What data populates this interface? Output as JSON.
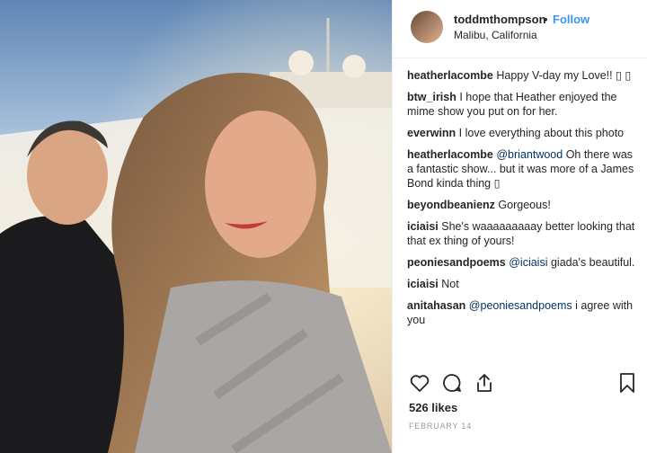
{
  "post": {
    "username": "toddmthompson",
    "separator": "•",
    "follow_label": "Follow",
    "location": "Malibu, California",
    "likes": "526 likes",
    "date": "FEBRUARY 14"
  },
  "comments": [
    {
      "user": "heatherlacombe",
      "mention": "",
      "text": "Happy V-day my Love!! ▯ ▯"
    },
    {
      "user": "btw_irish",
      "mention": "",
      "text": "I hope that Heather enjoyed the mime show you put on for her."
    },
    {
      "user": "everwinn",
      "mention": "",
      "text": "I love everything about this photo"
    },
    {
      "user": "heatherlacombe",
      "mention": "@briantwood",
      "text": "Oh there was a fantastic show... but it was more of a James Bond kinda thing ▯"
    },
    {
      "user": "beyondbeanienz",
      "mention": "",
      "text": "Gorgeous!"
    },
    {
      "user": "iciaisi",
      "mention": "",
      "text": "She's waaaaaaaaay better looking that that ex thing of yours!"
    },
    {
      "user": "peoniesandpoems",
      "mention": "@iciaisi",
      "text": "giada's beautiful."
    },
    {
      "user": "iciaisi",
      "mention": "",
      "text": "Not"
    },
    {
      "user": "anitahasan",
      "mention": "@peoniesandpoems",
      "text": "i agree with you"
    }
  ],
  "icons": {
    "like": "heart-icon",
    "comment": "comment-icon",
    "share": "share-icon",
    "save": "bookmark-icon"
  },
  "colors": {
    "link": "#3897f0",
    "mention": "#003569",
    "muted": "#999999"
  }
}
